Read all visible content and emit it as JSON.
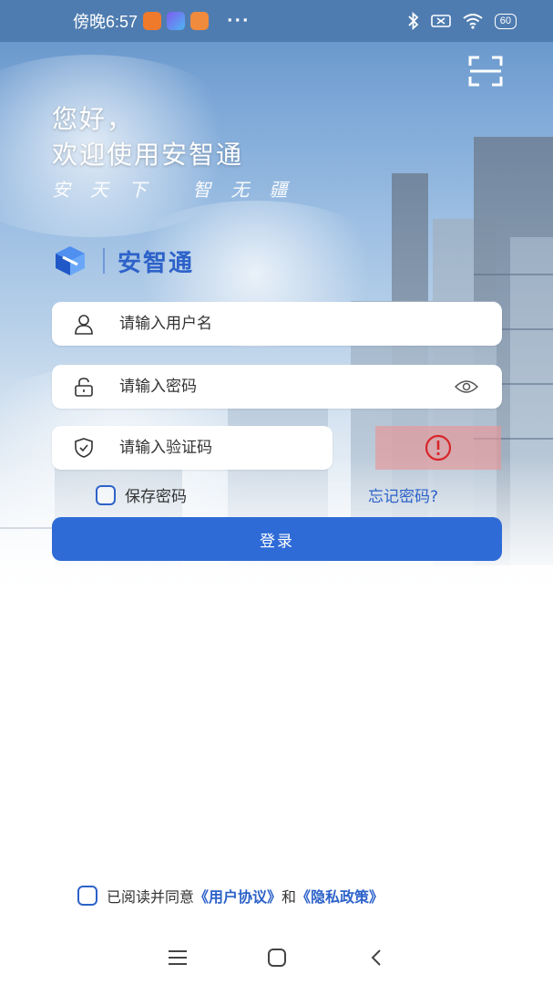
{
  "status_bar": {
    "time": "傍晚6:57",
    "battery": "60",
    "more_dots": "···"
  },
  "greeting": {
    "line1": "您好，",
    "line2": "欢迎使用安智通",
    "slogan": "安天下 智无疆"
  },
  "brand": {
    "name": "安智通",
    "color": "#2d62c9"
  },
  "form": {
    "username_placeholder": "请输入用户名",
    "password_placeholder": "请输入密码",
    "captcha_placeholder": "请输入验证码",
    "save_password_label": "保存密码",
    "forgot_password_label": "忘记密码?",
    "login_label": "登录"
  },
  "agreement": {
    "prefix": "已阅读并同意",
    "user_agreement": "《用户协议》",
    "conjunction": "和",
    "privacy_policy": "《隐私政策》"
  },
  "colors": {
    "accent": "#2e6bd6",
    "captcha_error_bg": "#e89a9a",
    "captcha_error_icon": "#d9262b"
  },
  "icons": {
    "scan": "scan-icon",
    "user": "user-icon",
    "lock": "lock-icon",
    "eye": "eye-icon",
    "shield": "shield-icon",
    "error": "error-icon"
  }
}
